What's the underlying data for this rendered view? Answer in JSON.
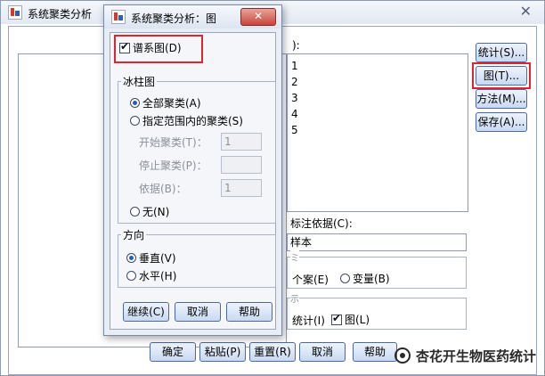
{
  "main_window": {
    "title": "系统聚类分析",
    "close_glyph": "✕",
    "variables_label_suffix": "):",
    "variable_items": [
      "1",
      "2",
      "3",
      "4",
      "5"
    ],
    "label_cases_label": "标注依据(C):",
    "label_cases_value": "样本",
    "cluster_group_label": "ミ",
    "cluster_cases": "个案(E)",
    "cluster_variables": "变量(B)",
    "display_group_label": "示",
    "display_stats": "统计(I)",
    "display_plots": "图(L)",
    "side_buttons": [
      "统计(S)...",
      "图(T)...",
      "方法(M)...",
      "保存(A)..."
    ],
    "bottom_buttons": [
      "确定",
      "粘贴(P)",
      "重置(R)",
      "取消",
      "帮助"
    ]
  },
  "dialog": {
    "title": "系统聚类分析：图",
    "close_glyph": "✕",
    "dendrogram": "谱系图(D)",
    "icicle_title": "冰柱图",
    "all_clusters": "全部聚类(A)",
    "specified_range": "指定范围内的聚类(S)",
    "start_cluster": "开始聚类(T)：",
    "start_value": "1",
    "stop_cluster": "停止聚类(P)：",
    "stop_value": "",
    "by_label": "依据(B)：",
    "by_value": "1",
    "none": "无(N)",
    "orientation_title": "方向",
    "vertical": "垂直(V)",
    "horizontal": "水平(H)",
    "buttons": [
      "继续(C)",
      "取消",
      "帮助"
    ]
  },
  "watermark": "杏花开生物医药统计",
  "colors": {
    "highlight": "#e0232e",
    "accent": "#245bc5"
  }
}
